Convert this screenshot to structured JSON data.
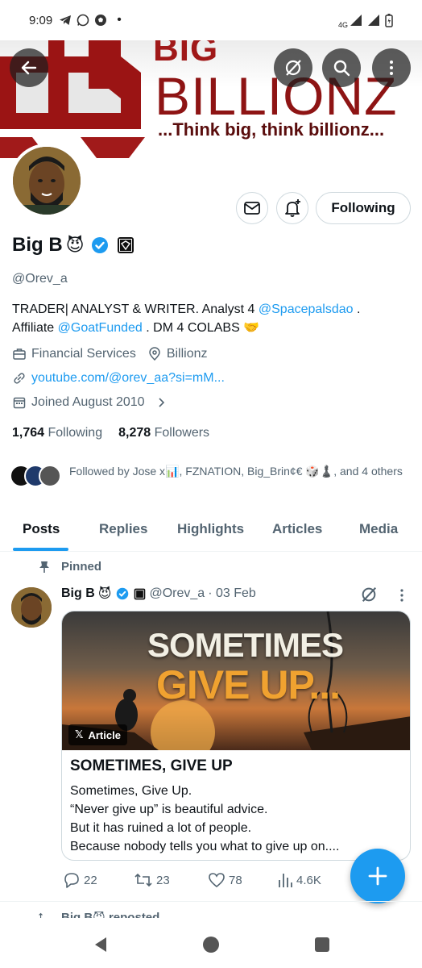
{
  "status_bar": {
    "time": "9:09",
    "network": "4G"
  },
  "banner": {
    "brand_top": "BIG",
    "brand": "BILLIONZ",
    "tagline": "...Think big, think billionz..."
  },
  "header_buttons": {
    "back": "back-arrow-icon",
    "grok": "grok-icon",
    "search": "search-icon",
    "more": "more-vertical-icon"
  },
  "profile": {
    "name": "Big B",
    "name_emoji": "😈",
    "handle": "@Orev_a",
    "bio_parts": [
      "TRADER| ANALYST & WRITER. Analyst 4 ",
      "@Spacepalsdao",
      " .",
      "Affiliate ",
      "@GoatFunded",
      " . DM 4 COLABS ",
      "🤝"
    ],
    "category": "Financial Services",
    "location": "Billionz",
    "website": "youtube.com/@orev_aa?si=mM...",
    "joined": "Joined August 2010",
    "following_count": "1,764",
    "following_label": "Following",
    "followers_count": "8,278",
    "followers_label": "Followers",
    "followed_by": "Followed by Jose x📊, FZNATION, Big_Brin¢€ 🎲♟️, and 4 others",
    "follow_button": "Following"
  },
  "tabs": [
    "Posts",
    "Replies",
    "Highlights",
    "Articles",
    "Media"
  ],
  "active_tab": "Posts",
  "pinned_post": {
    "pinned_label": "Pinned",
    "author": "Big B",
    "author_emoji": "😈",
    "handle": "@Orev_a",
    "date": "· 03 Feb",
    "image_title_line1": "SOMETIMES",
    "image_title_line2": "GIVE UP...",
    "article_badge": "Article",
    "article_title": "SOMETIMES, GIVE UP",
    "article_lines": [
      "Sometimes, Give Up.",
      "“Never give up” is beautiful advice.",
      "But it has ruined a lot of people.",
      "Because nobody tells you what to give up on...."
    ],
    "replies": "22",
    "reposts": "23",
    "likes": "78",
    "views": "4.6K"
  },
  "next_post_peek": {
    "text": "Big B😈 reposted"
  },
  "colors": {
    "accent": "#1d9bf0",
    "text": "#0f1419",
    "muted": "#536471",
    "brand_red": "#8e1414"
  }
}
